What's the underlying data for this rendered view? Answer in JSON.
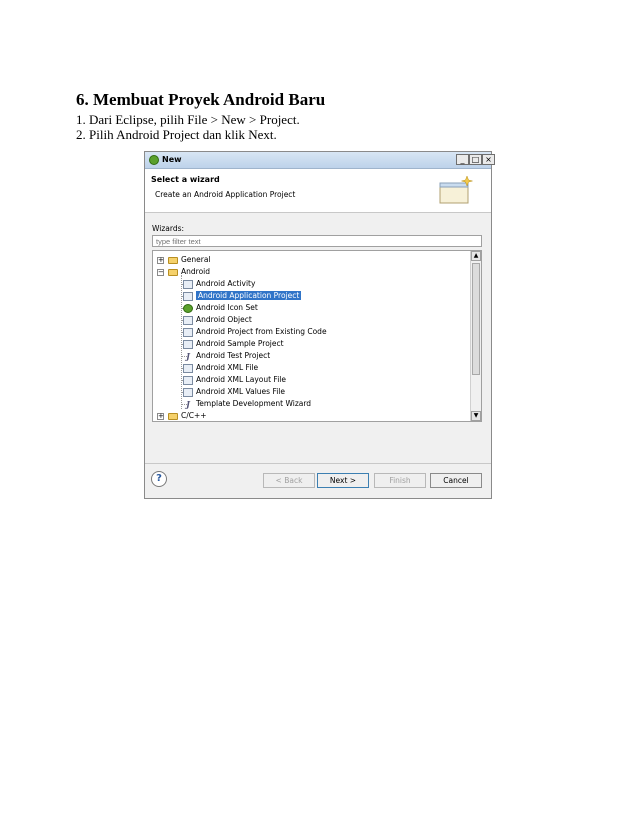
{
  "heading": "6. Membuat Proyek Android Baru",
  "steps": [
    "1. Dari Eclipse, pilih File > New > Project.",
    "2. Pilih Android Project dan klik Next."
  ],
  "dialog": {
    "title": "New",
    "window_buttons": {
      "minimize": "_",
      "maximize": "□",
      "close": "×"
    },
    "header_title": "Select a wizard",
    "header_subtitle": "Create an Android Application Project",
    "wizards_label": "Wizards:",
    "filter_placeholder": "type filter text",
    "tree": {
      "general": "General",
      "android": "Android",
      "android_items": [
        "Android Activity",
        "Android Application Project",
        "Android Icon Set",
        "Android Object",
        "Android Project from Existing Code",
        "Android Sample Project",
        "Android Test Project",
        "Android XML File",
        "Android XML Layout File",
        "Android XML Values File",
        "Template Development Wizard"
      ],
      "cpp": "C/C++",
      "selected": "Android Application Project"
    },
    "buttons": {
      "help": "?",
      "back": "< Back",
      "next": "Next >",
      "finish": "Finish",
      "cancel": "Cancel"
    }
  },
  "colors": {
    "selection": "#3074c8",
    "titlebar": "#bdd2ea"
  }
}
